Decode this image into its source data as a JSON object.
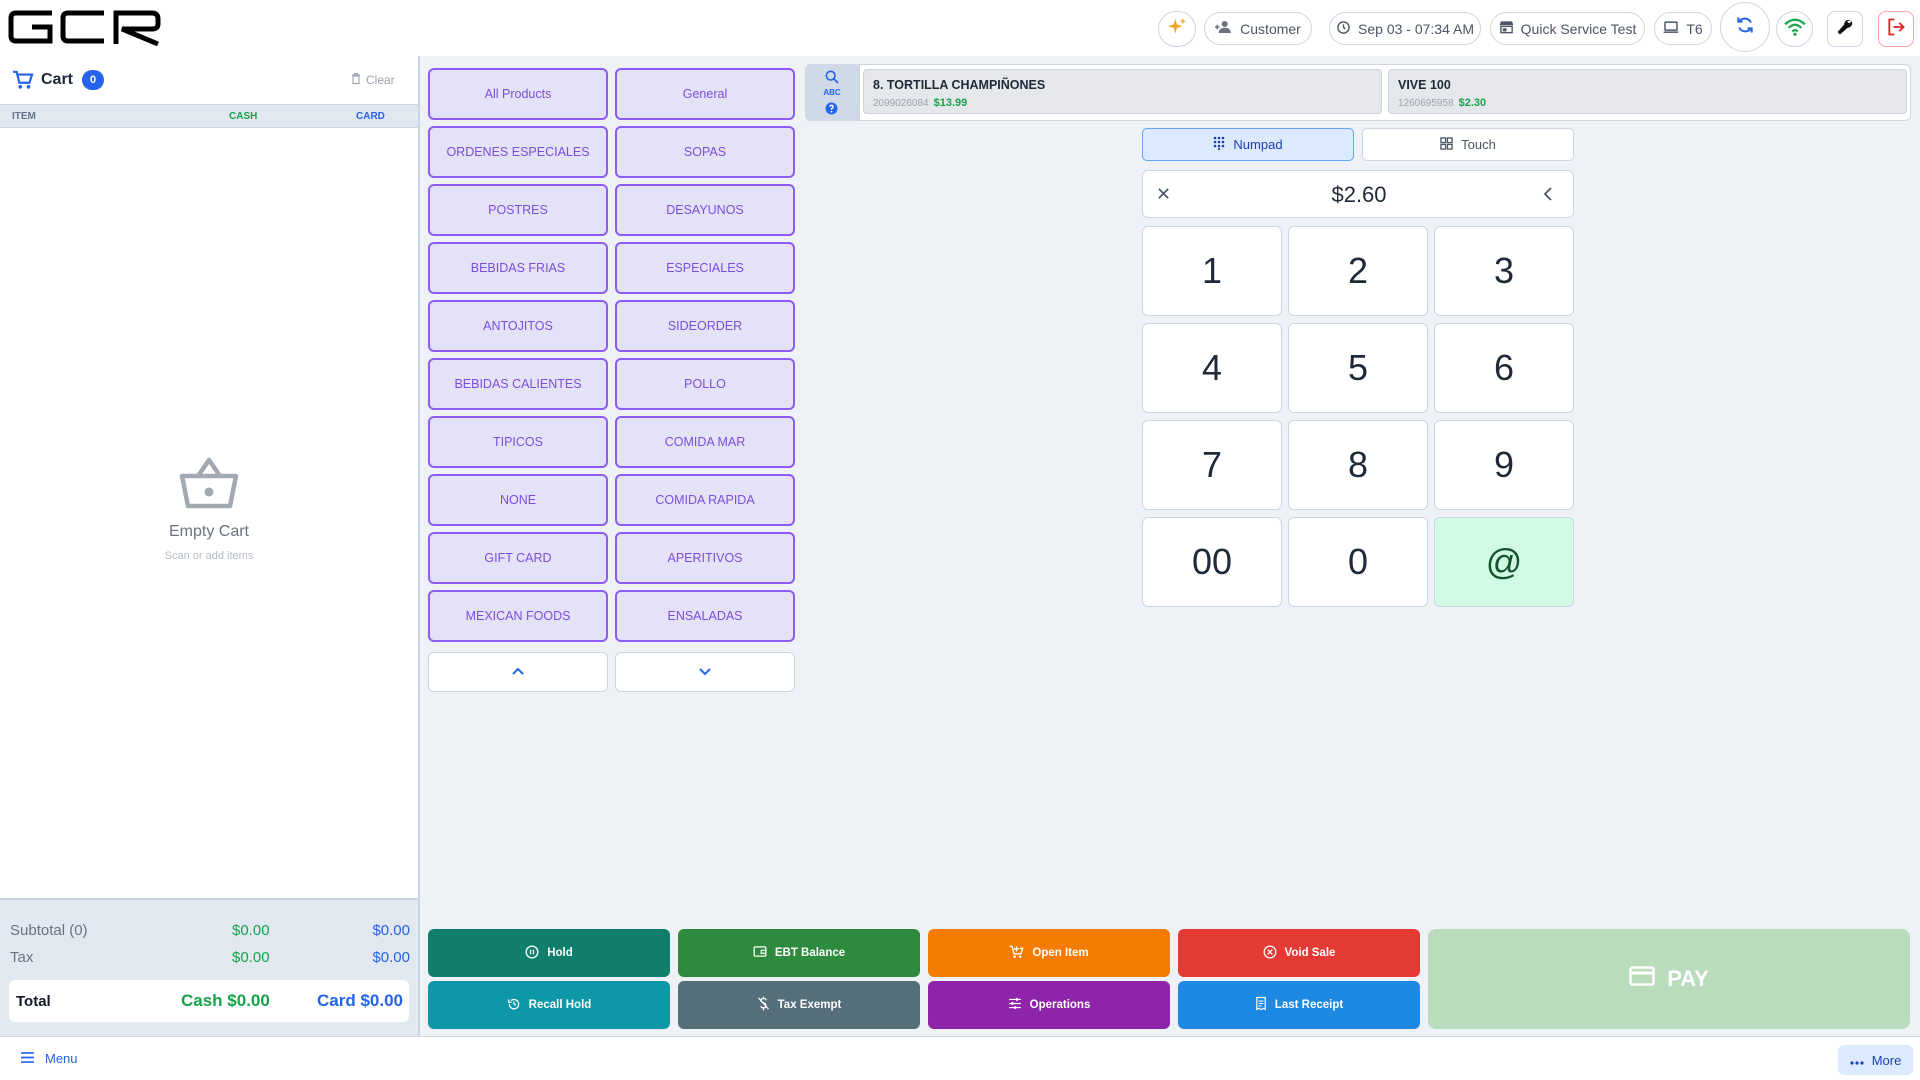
{
  "app": {
    "logo_text": "GCR"
  },
  "header": {
    "customer_label": "Customer",
    "datetime": "Sep 03 - 07:34 AM",
    "store_name": "Quick Service Test",
    "terminal": "T6",
    "icons": [
      "sparkle-icon",
      "add-customer-icon",
      "clock-icon",
      "store-icon",
      "monitor-icon",
      "sync-icon",
      "wifi-icon",
      "wrench-icon",
      "logout-icon"
    ]
  },
  "cart": {
    "title": "Cart",
    "count": "0",
    "clear_label": "Clear",
    "columns": {
      "item": "ITEM",
      "cash": "CASH",
      "card": "CARD"
    },
    "empty_title": "Empty Cart",
    "empty_subtitle": "Scan or add items",
    "subtotal_label": "Subtotal (0)",
    "subtotal_cash": "$0.00",
    "subtotal_card": "$0.00",
    "tax_label": "Tax",
    "tax_cash": "$0.00",
    "tax_card": "$0.00",
    "total_label": "Total",
    "total_cash": "Cash $0.00",
    "total_card": "Card $0.00"
  },
  "categories": [
    "All Products",
    "General",
    "ORDENES ESPECIALES",
    "SOPAS",
    "POSTRES",
    "DESAYUNOS",
    "BEBIDAS FRIAS",
    "ESPECIALES",
    "ANTOJITOS",
    "SIDEORDER",
    "BEBIDAS CALIENTES",
    "POLLO",
    "TIPICOS",
    "COMIDA MAR",
    "NONE",
    "COMIDA RAPIDA",
    "GIFT CARD",
    "APERITIVOS",
    "MEXICAN FOODS",
    "ENSALADAS"
  ],
  "search": {
    "abc_label": "ABC"
  },
  "quick_items": [
    {
      "name": "8. TORTILLA CHAMPIÑONES",
      "code": "2099026084",
      "price": "$13.99"
    },
    {
      "name": "VIVE 100",
      "code": "1260695958",
      "price": "$2.30"
    }
  ],
  "numpad": {
    "mode_numpad": "Numpad",
    "mode_touch": "Touch",
    "amount": "$2.60",
    "keys": [
      "1",
      "2",
      "3",
      "4",
      "5",
      "6",
      "7",
      "8",
      "9",
      "00",
      "0",
      "@"
    ]
  },
  "actions": {
    "hold": "Hold",
    "ebt_balance": "EBT Balance",
    "open_item": "Open Item",
    "void_sale": "Void Sale",
    "recall_hold": "Recall Hold",
    "tax_exempt": "Tax Exempt",
    "operations": "Operations",
    "last_receipt": "Last Receipt",
    "pay": "PAY"
  },
  "colors": {
    "hold": "#0f7f6c",
    "ebt_balance": "#2e8b3e",
    "open_item": "#f57c00",
    "void_sale": "#e53935",
    "recall_hold": "#0e97a7",
    "tax_exempt": "#546e7a",
    "operations": "#8e24aa",
    "last_receipt": "#1e88e5",
    "pay": "#b9dcbd",
    "category_border": "#8b5cf6",
    "category_bg": "#e4e2f7"
  },
  "footer": {
    "menu_label": "Menu",
    "more_label": "More"
  }
}
